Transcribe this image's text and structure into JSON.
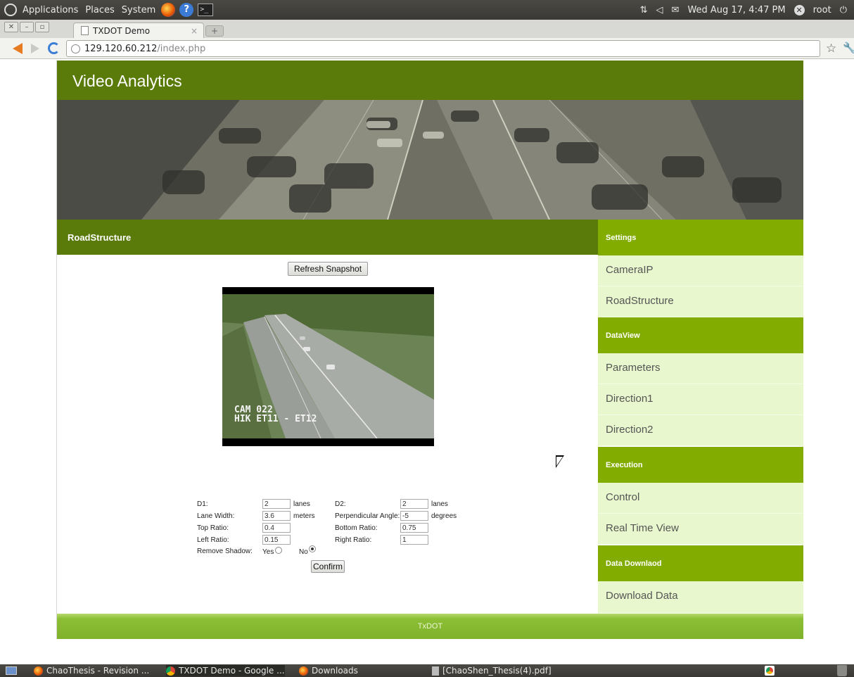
{
  "system": {
    "menus": [
      "Applications",
      "Places",
      "System"
    ],
    "clock": "Wed Aug 17,  4:47 PM",
    "user": "root"
  },
  "browser": {
    "tab_title": "TXDOT Demo",
    "url_host": "129.120.60.212",
    "url_path": "/index.php",
    "new_tab_glyph": "+",
    "tab_close_glyph": "×"
  },
  "site": {
    "title": "Video Analytics",
    "content_header": "RoadStructure",
    "refresh_button": "Refresh Snapshot",
    "snapshot_caption_line1": "CAM 022",
    "snapshot_caption_line2": "HIK ET11 - ET12",
    "footer": "TxDOT"
  },
  "form": {
    "d1_label": "D1:",
    "d1_value": "2",
    "d1_unit": "lanes",
    "d2_label": "D2:",
    "d2_value": "2",
    "d2_unit": "lanes",
    "lane_width_label": "Lane Width:",
    "lane_width_value": "3.6",
    "lane_width_unit": "meters",
    "perp_angle_label": "Perpendicular Angle:",
    "perp_angle_value": "-5",
    "perp_angle_unit": "degrees",
    "top_ratio_label": "Top Ratio:",
    "top_ratio_value": "0.4",
    "bottom_ratio_label": "Bottom Ratio:",
    "bottom_ratio_value": "0.75",
    "left_ratio_label": "Left Ratio:",
    "left_ratio_value": "0.15",
    "right_ratio_label": "Right Ratio:",
    "right_ratio_value": "1",
    "remove_shadow_label": "Remove Shadow:",
    "yes_label": "Yes",
    "no_label": "No",
    "remove_shadow_selected": "No",
    "confirm_button": "Confirm"
  },
  "sidebar": {
    "settings_head": "Settings",
    "camera_ip": "CameraIP",
    "road_structure": "RoadStructure",
    "dataview_head": "DataView",
    "parameters": "Parameters",
    "direction1": "Direction1",
    "direction2": "Direction2",
    "execution_head": "Execution",
    "control": "Control",
    "real_time_view": "Real Time View",
    "download_head": "Data Downlaod",
    "download_data": "Download Data"
  },
  "taskbar": {
    "items": [
      "ChaoThesis - Revision ...",
      "TXDOT Demo - Google ...",
      "Downloads",
      "[ChaoShen_Thesis(4).pdf]"
    ]
  },
  "colors": {
    "header_green": "#5a7a0a",
    "sidebar_head_green": "#82ad00",
    "sidebar_item_bg": "#e8f7cd"
  }
}
